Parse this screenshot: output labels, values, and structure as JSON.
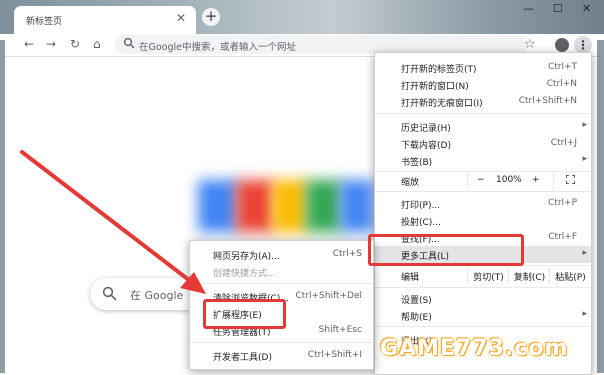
{
  "browser": {
    "tab_title": "新标签页",
    "tab_close_glyph": "✕",
    "new_tab_glyph": "+",
    "window_controls": [
      "—",
      "☐",
      "✕"
    ],
    "omnibox_placeholder": "在Google中搜索，或者输入一个网址",
    "nav_icons": [
      "back-arrow-icon",
      "forward-arrow-icon",
      "reload-icon",
      "home-icon",
      "search-icon",
      "star-icon",
      "profile-icon",
      "kebab-menu-icon"
    ]
  },
  "ntp": {
    "search_placeholder": "在 Google"
  },
  "main_menu": {
    "items_top": [
      {
        "label": "打开新的标签页(T)",
        "shortcut": "Ctrl+T"
      },
      {
        "label": "打开新的窗口(N)",
        "shortcut": "Ctrl+N"
      },
      {
        "label": "打开新的无痕窗口(I)",
        "shortcut": "Ctrl+Shift+N"
      }
    ],
    "items_history": [
      {
        "label": "历史记录(H)",
        "arrow": "▸"
      },
      {
        "label": "下载内容(D)",
        "shortcut": "Ctrl+J"
      },
      {
        "label": "书签(B)",
        "arrow": "▸"
      }
    ],
    "zoom": {
      "label": "缩放",
      "minus": "−",
      "value": "100%",
      "plus": "+"
    },
    "items_print": [
      {
        "label": "打印(P)...",
        "shortcut": "Ctrl+P"
      },
      {
        "label": "投射(C)..."
      },
      {
        "label": "查找(F)...",
        "shortcut": "Ctrl+F"
      },
      {
        "label": "更多工具(L)",
        "arrow": "▸"
      }
    ],
    "edit": {
      "label": "编辑",
      "cut": "剪切(T)",
      "copy": "复制(C)",
      "paste": "粘贴(P)"
    },
    "items_bottom": [
      {
        "label": "设置(S)"
      },
      {
        "label": "帮助(E)",
        "arrow": "▸"
      },
      {
        "label": "退出(X)"
      }
    ]
  },
  "sub_menu": {
    "items": [
      {
        "label": "网页另存为(A)...",
        "shortcut": "Ctrl+S"
      },
      {
        "label": "创建快捷方式..."
      },
      {
        "label": "清除浏览数据(C)...",
        "shortcut": "Ctrl+Shift+Del"
      },
      {
        "label": "扩展程序(E)"
      },
      {
        "label": "任务管理器(T)",
        "shortcut": "Shift+Esc"
      },
      {
        "label": "开发者工具(D)",
        "shortcut": "Ctrl+Shift+I"
      }
    ]
  },
  "watermark": "GAME773.com",
  "colors": {
    "highlight_red": "#e53935",
    "menu_hover": "#e4e4e4",
    "watermark_outline": "#f6a623"
  }
}
